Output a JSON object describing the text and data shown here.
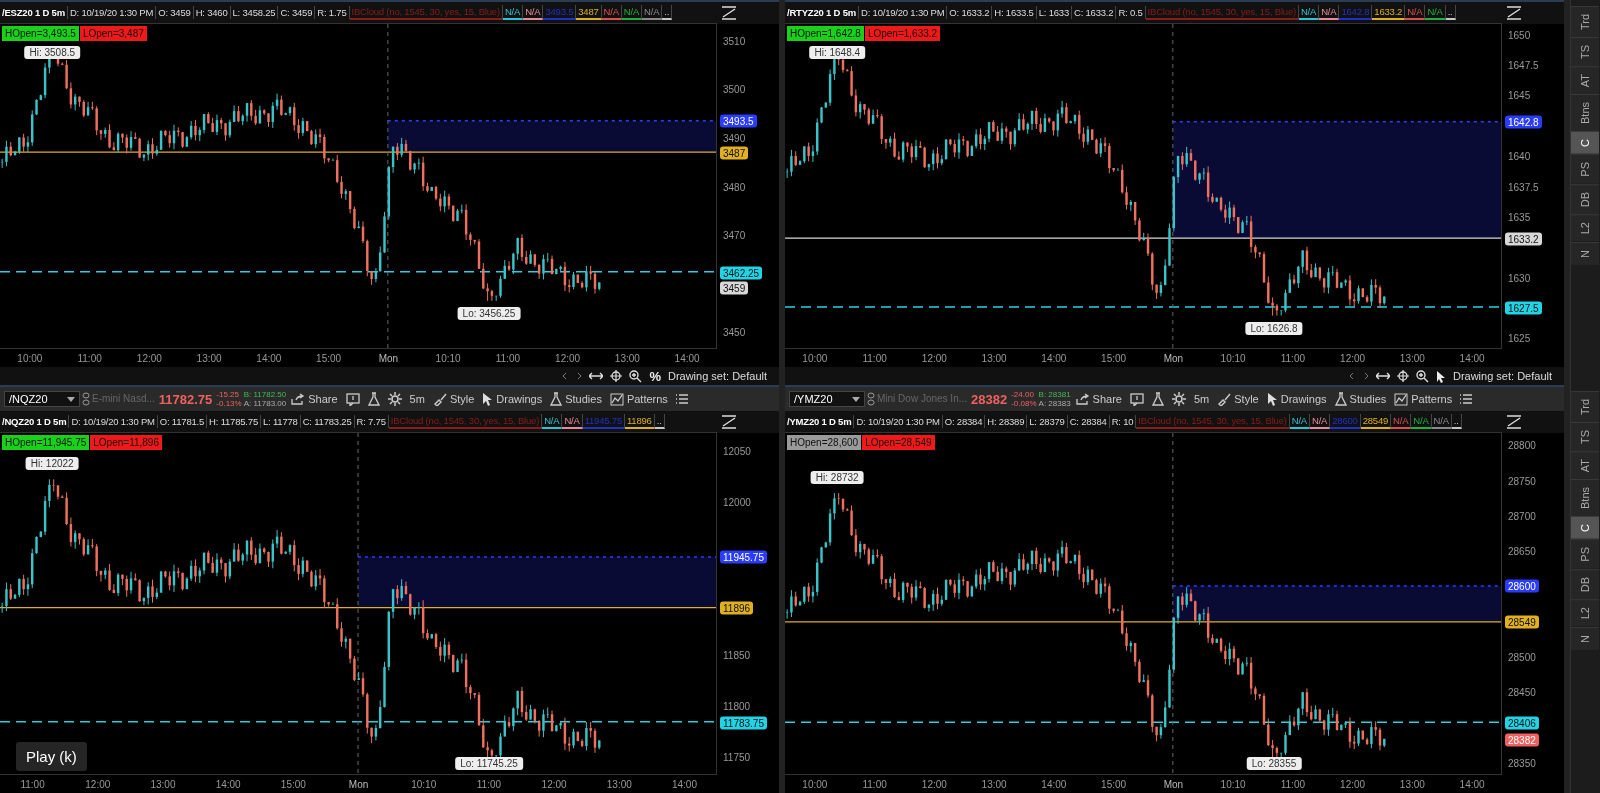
{
  "charts": [
    {
      "info": {
        "header": "/ESZ20 1 D 5m",
        "fields": [
          "D: 10/19/20 1:30 PM",
          "O: 3459",
          "H: 3460",
          "L: 3458.25",
          "C: 3459",
          "R: 1.75"
        ],
        "studies": [
          {
            "text": "IBCloud (no, 1545, 30, yes, 15, Blue)",
            "color": "#8a1c1c"
          },
          {
            "text": "N/A",
            "color": "#2ec4d6"
          },
          {
            "text": "N/A",
            "color": "#e88a9a"
          },
          {
            "text": "3493.5",
            "color": "#2030c8"
          },
          {
            "text": "3487",
            "color": "#e0b020"
          },
          {
            "text": "N/A",
            "color": "#e05050"
          },
          {
            "text": "N/A",
            "color": "#20b040"
          },
          {
            "text": "N/A",
            "color": "#8a8a8a"
          },
          {
            "text": "..",
            "color": "#c8c8c8"
          }
        ]
      },
      "open_badges": [
        {
          "text": "HOpen=3,493.5",
          "color": "#19d119"
        },
        {
          "text": "LOpen=3,487",
          "color": "#f01818"
        }
      ],
      "hi_label": "Hi: 3508.5",
      "lo_label": "Lo: 3456.25",
      "price_ticks": [
        "3510",
        "3500",
        "3490",
        "3480",
        "3470",
        "3450"
      ],
      "price_markers": [
        {
          "kind": "high_open",
          "text": "3493.5",
          "color": "#2a3cff"
        },
        {
          "kind": "low_open",
          "text": "3487",
          "color": "#e0b020"
        },
        {
          "kind": "level",
          "text": "3462.25",
          "color": "#22d3e6"
        },
        {
          "kind": "last",
          "text": "3459",
          "color": "#d8d8d8"
        }
      ],
      "time_ticks": [
        {
          "label": "10:00",
          "session_start": false
        },
        {
          "label": "11:00",
          "session_start": false
        },
        {
          "label": "12:00",
          "session_start": false
        },
        {
          "label": "13:00",
          "session_start": false
        },
        {
          "label": "14:00",
          "session_start": false
        },
        {
          "label": "15:00",
          "session_start": false
        },
        {
          "label": "Mon",
          "session_start": true
        },
        {
          "label": "10:10",
          "session_start": false
        },
        {
          "label": "11:00",
          "session_start": false
        },
        {
          "label": "12:00",
          "session_start": false
        },
        {
          "label": "13:00",
          "session_start": false
        },
        {
          "label": "14:00",
          "session_start": false
        }
      ],
      "bottom_bar": {
        "tool": {
          "kind": "percent",
          "text": "%"
        },
        "drawing_set": "Drawing set: Default"
      }
    },
    {
      "info": {
        "header": "/RTYZ20 1 D 5m",
        "fields": [
          "D: 10/19/20 1:30 PM",
          "O: 1633.2",
          "H: 1633.5",
          "L: 1633",
          "C: 1633.2",
          "R: 0.5"
        ],
        "studies": [
          {
            "text": "IBCloud (no, 1545, 30, yes, 15, Blue)",
            "color": "#8a1c1c"
          },
          {
            "text": "N/A",
            "color": "#2ec4d6"
          },
          {
            "text": "N/A",
            "color": "#e88a9a"
          },
          {
            "text": "1642.8",
            "color": "#2030c8"
          },
          {
            "text": "1633.2",
            "color": "#e0b020"
          },
          {
            "text": "N/A",
            "color": "#e05050"
          },
          {
            "text": "N/A",
            "color": "#20b040"
          },
          {
            "text": "..",
            "color": "#c8c8c8"
          }
        ]
      },
      "open_badges": [
        {
          "text": "HOpen=1,642.8",
          "color": "#19d119"
        },
        {
          "text": "LOpen=1,633.2",
          "color": "#f01818"
        }
      ],
      "hi_label": "Hi: 1648.4",
      "lo_label": "Lo: 1626.8",
      "price_ticks": [
        "1650",
        "1647.5",
        "1645",
        "1640",
        "1637.5",
        "1635",
        "1630",
        "1625"
      ],
      "price_markers": [
        {
          "kind": "high_open",
          "text": "1642.8",
          "color": "#2a3cff"
        },
        {
          "kind": "low_open",
          "text": "1633.2",
          "color": "#d8d8d8"
        },
        {
          "kind": "level",
          "text": "1627.5",
          "color": "#22d3e6"
        }
      ],
      "time_ticks": [
        {
          "label": "10:00",
          "session_start": false
        },
        {
          "label": "11:00",
          "session_start": false
        },
        {
          "label": "12:00",
          "session_start": false
        },
        {
          "label": "13:00",
          "session_start": false
        },
        {
          "label": "14:00",
          "session_start": false
        },
        {
          "label": "15:00",
          "session_start": false
        },
        {
          "label": "Mon",
          "session_start": true
        },
        {
          "label": "10:10",
          "session_start": false
        },
        {
          "label": "11:00",
          "session_start": false
        },
        {
          "label": "12:00",
          "session_start": false
        },
        {
          "label": "13:00",
          "session_start": false
        },
        {
          "label": "14:00",
          "session_start": false
        }
      ],
      "bottom_bar": {
        "tool": {
          "kind": "pointer"
        },
        "drawing_set": "Drawing set: Default"
      }
    },
    {
      "toolbar": {
        "symbol": "/NQZ20",
        "description": "E-mini Nasd...",
        "last": "11782.75",
        "change": "-15.25",
        "change_pct": "-0.13%",
        "bid": "B: 11782.50",
        "ask": "A: 11783.00",
        "buttons": [
          {
            "kind": "share",
            "label": "Share"
          },
          {
            "kind": "note"
          },
          {
            "kind": "flask"
          },
          {
            "kind": "settings"
          },
          {
            "kind": "timeframe",
            "label": "5m"
          },
          {
            "kind": "style",
            "label": "Style"
          },
          {
            "kind": "drawings",
            "label": "Drawings"
          },
          {
            "kind": "studies",
            "label": "Studies"
          },
          {
            "kind": "patterns",
            "label": "Patterns"
          },
          {
            "kind": "menu"
          }
        ]
      },
      "info": {
        "header": "/NQZ20 1 D 5m",
        "fields": [
          "D: 10/19/20 1:30 PM",
          "O: 11781.5",
          "H: 11785.75",
          "L: 11778",
          "C: 11783.25",
          "R: 7.75"
        ],
        "studies": [
          {
            "text": "IBCloud (no, 1545, 30, yes, 15, Blue)",
            "color": "#8a1c1c"
          },
          {
            "text": "N/A",
            "color": "#2ec4d6"
          },
          {
            "text": "N/A",
            "color": "#e88a9a"
          },
          {
            "text": "11945.75",
            "color": "#2030c8"
          },
          {
            "text": "11896",
            "color": "#e0b020"
          },
          {
            "text": "..",
            "color": "#c8c8c8"
          }
        ]
      },
      "open_badges": [
        {
          "text": "HOpen=11,945.75",
          "color": "#19d119"
        },
        {
          "text": "LOpen=11,896",
          "color": "#f01818"
        }
      ],
      "hi_label": "Hi: 12022",
      "lo_label": "Lo: 11745.25",
      "price_ticks": [
        "12050",
        "12000",
        "11850",
        "11800",
        "11750"
      ],
      "price_markers": [
        {
          "kind": "high_open",
          "text": "11945.75",
          "color": "#2a3cff"
        },
        {
          "kind": "low_open",
          "text": "11896",
          "color": "#e0b020"
        },
        {
          "kind": "level",
          "text": "11783.75",
          "color": "#22d3e6"
        }
      ],
      "time_ticks": [
        {
          "label": "11:00",
          "session_start": false
        },
        {
          "label": "12:00",
          "session_start": false
        },
        {
          "label": "13:00",
          "session_start": false
        },
        {
          "label": "14:00",
          "session_start": false
        },
        {
          "label": "15:00",
          "session_start": false
        },
        {
          "label": "Mon",
          "session_start": true
        },
        {
          "label": "10:10",
          "session_start": false
        },
        {
          "label": "11:00",
          "session_start": false
        },
        {
          "label": "12:00",
          "session_start": false
        },
        {
          "label": "13:00",
          "session_start": false
        },
        {
          "label": "14:00",
          "session_start": false
        }
      ]
    },
    {
      "toolbar": {
        "symbol": "/YMZ20",
        "description": "Mini Dow Jones In...",
        "last": "28382",
        "change": "-24.00",
        "change_pct": "-0.08%",
        "bid": "B: 28381",
        "ask": "A: 28383",
        "buttons": [
          {
            "kind": "share",
            "label": "Share"
          },
          {
            "kind": "note"
          },
          {
            "kind": "flask"
          },
          {
            "kind": "settings"
          },
          {
            "kind": "timeframe",
            "label": "5m"
          },
          {
            "kind": "style",
            "label": "Style"
          },
          {
            "kind": "drawings",
            "label": "Drawings"
          },
          {
            "kind": "studies",
            "label": "Studies"
          },
          {
            "kind": "patterns",
            "label": "Patterns"
          },
          {
            "kind": "menu"
          }
        ]
      },
      "info": {
        "header": "/YMZ20 1 D 5m",
        "fields": [
          "D: 10/19/20 1:30 PM",
          "O: 28384",
          "H: 28389",
          "L: 28379",
          "C: 28384",
          "R: 10"
        ],
        "studies": [
          {
            "text": "IBCloud (no, 1545, 30, yes, 15, Blue)",
            "color": "#8a1c1c"
          },
          {
            "text": "N/A",
            "color": "#2ec4d6"
          },
          {
            "text": "N/A",
            "color": "#e88a9a"
          },
          {
            "text": "28600",
            "color": "#2030c8"
          },
          {
            "text": "28549",
            "color": "#e0b020"
          },
          {
            "text": "N/A",
            "color": "#e05050"
          },
          {
            "text": "N/A",
            "color": "#20b040"
          },
          {
            "text": "N/A",
            "color": "#8a8a8a"
          },
          {
            "text": "..",
            "color": "#c8c8c8"
          }
        ]
      },
      "open_badges": [
        {
          "text": "HOpen=28,600",
          "color": "#9a9a9a"
        },
        {
          "text": "LOpen=28,549",
          "color": "#f01818"
        }
      ],
      "hi_label": "Hi: 28732",
      "lo_label": "Lo: 28355",
      "price_ticks": [
        "28800",
        "28750",
        "28700",
        "28650",
        "28500",
        "28450",
        "28350"
      ],
      "price_markers": [
        {
          "kind": "high_open",
          "text": "28600",
          "color": "#2a3cff"
        },
        {
          "kind": "low_open",
          "text": "28549",
          "color": "#e0b020"
        },
        {
          "kind": "level",
          "text": "28406",
          "color": "#22d3e6"
        },
        {
          "kind": "last",
          "text": "28382",
          "color": "#f06060"
        }
      ],
      "time_ticks": [
        {
          "label": "10:00",
          "session_start": false
        },
        {
          "label": "11:00",
          "session_start": false
        },
        {
          "label": "12:00",
          "session_start": false
        },
        {
          "label": "13:00",
          "session_start": false
        },
        {
          "label": "14:00",
          "session_start": false
        },
        {
          "label": "15:00",
          "session_start": false
        },
        {
          "label": "Mon",
          "session_start": true
        },
        {
          "label": "10:10",
          "session_start": false
        },
        {
          "label": "11:00",
          "session_start": false
        },
        {
          "label": "12:00",
          "session_start": false
        },
        {
          "label": "13:00",
          "session_start": false
        },
        {
          "label": "14:00",
          "session_start": false
        }
      ]
    }
  ],
  "sidebars": [
    {
      "tabs": [
        {
          "label": "Trd",
          "selected": false
        },
        {
          "label": "TS",
          "selected": false
        },
        {
          "label": "AT",
          "selected": false
        },
        {
          "label": "Btns",
          "selected": false
        },
        {
          "label": "C",
          "selected": true
        },
        {
          "label": "PS",
          "selected": false
        },
        {
          "label": "DB",
          "selected": false
        },
        {
          "label": "L2",
          "selected": false
        },
        {
          "label": "N",
          "selected": false
        }
      ]
    },
    {
      "tabs": [
        {
          "label": "Trd",
          "selected": false
        },
        {
          "label": "TS",
          "selected": false
        },
        {
          "label": "AT",
          "selected": false
        },
        {
          "label": "Btns",
          "selected": false
        },
        {
          "label": "C",
          "selected": true
        },
        {
          "label": "PS",
          "selected": false
        },
        {
          "label": "DB",
          "selected": false
        },
        {
          "label": "L2",
          "selected": false
        },
        {
          "label": "N",
          "selected": false
        }
      ]
    }
  ],
  "play_tooltip": "Play (k)"
}
